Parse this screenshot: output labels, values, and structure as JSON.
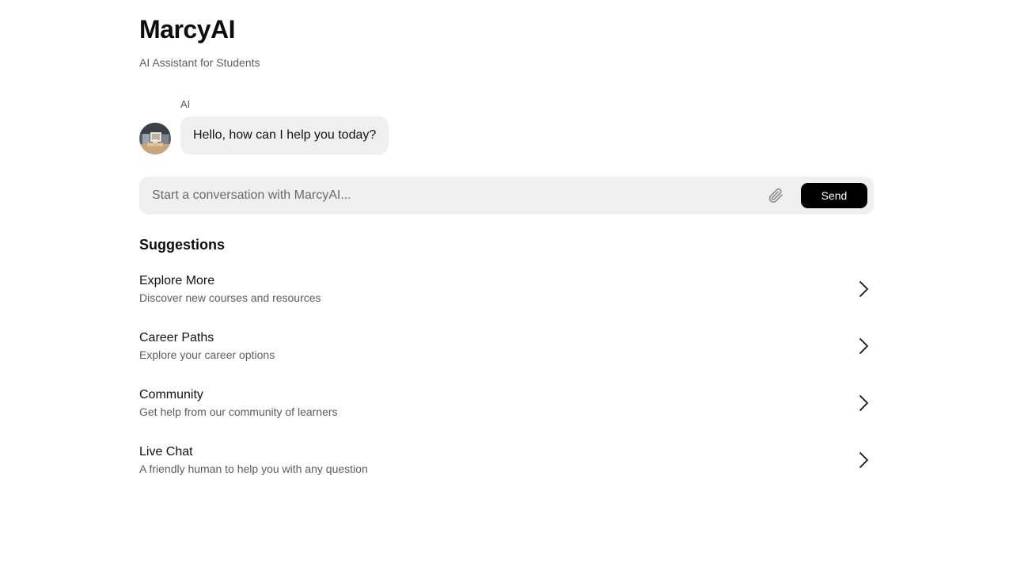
{
  "app": {
    "title": "MarcyAI",
    "subtitle": "AI Assistant for Students"
  },
  "chat": {
    "messages": [
      {
        "sender": "AI",
        "avatar_icon": "assistant-avatar",
        "text": "Hello, how can I help you today?"
      }
    ]
  },
  "composer": {
    "placeholder": "Start a conversation with MarcyAI...",
    "value": "",
    "attach_icon": "paperclip-icon",
    "send_label": "Send"
  },
  "suggestions": {
    "heading": "Suggestions",
    "items": [
      {
        "title": "Explore More",
        "description": "Discover new courses and resources",
        "icon": "chevron-right-icon"
      },
      {
        "title": "Career Paths",
        "description": "Explore your career options",
        "icon": "chevron-right-icon"
      },
      {
        "title": "Community",
        "description": "Get help from our community of learners",
        "icon": "chevron-right-icon"
      },
      {
        "title": "Live Chat",
        "description": "A friendly human to help you with any question",
        "icon": "chevron-right-icon"
      }
    ]
  },
  "colors": {
    "background": "#ffffff",
    "surface": "#efefef",
    "text_primary": "#0d0d0d",
    "text_secondary": "#5c5c5c",
    "send_button": "#000000"
  }
}
